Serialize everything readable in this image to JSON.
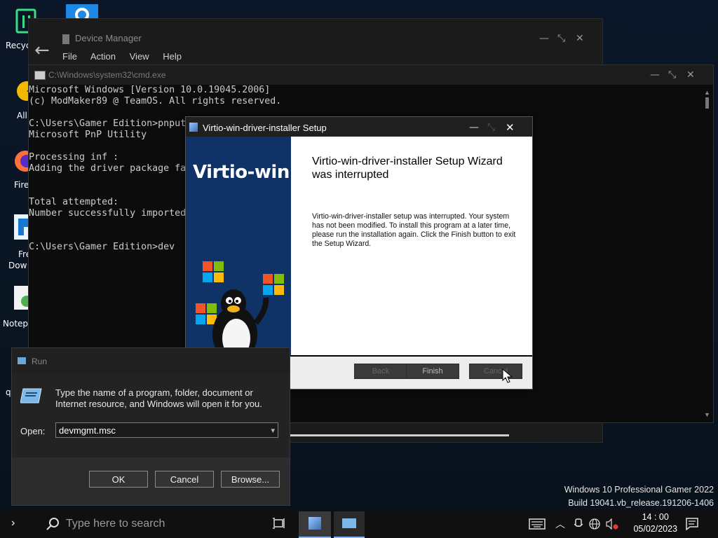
{
  "desktop": {
    "icons": [
      {
        "label": "Recyc"
      },
      {
        "label": "All"
      },
      {
        "label": "Fire"
      },
      {
        "label": "Fre"
      },
      {
        "label": "Dow"
      },
      {
        "label": "Notep"
      },
      {
        "label": "q"
      }
    ]
  },
  "device_manager": {
    "title": "Device Manager",
    "menu": [
      "File",
      "Action",
      "View",
      "Help"
    ]
  },
  "cmd": {
    "title": "C:\\Windows\\system32\\cmd.exe",
    "lines": [
      "Microsoft Windows [Version 10.0.19045.2006]",
      "(c) ModMaker89 @ TeamOS. All rights reserved.",
      "",
      "C:\\Users\\Gamer Edition>pnputi",
      "Microsoft PnP Utility",
      "",
      "Processing inf :",
      "Adding the driver package fa",
      "",
      "",
      "Total attempted:",
      "Number successfully imported",
      "",
      "",
      "C:\\Users\\Gamer Edition>dev"
    ]
  },
  "setup": {
    "title": "Virtio-win-driver-installer Setup",
    "brand": "Virtio-win",
    "heading": "Virtio-win-driver-installer Setup Wizard was interrupted",
    "body": "Virtio-win-driver-installer setup was interrupted. Your system has not been modified. To install this program at a later time, please run the installation again. Click the Finish button to exit the Setup Wizard.",
    "buttons": {
      "back": "Back",
      "finish": "Finish",
      "cancel": "Cancel"
    }
  },
  "run": {
    "title": "Run",
    "description": "Type the name of a program, folder, document or Internet resource, and Windows will open it for you.",
    "open_label": "Open:",
    "open_value": "devmgmt.msc",
    "buttons": {
      "ok": "OK",
      "cancel": "Cancel",
      "browse": "Browse..."
    }
  },
  "watermark": {
    "line1": "Windows 10 Professional Gamer 2022",
    "line2": "Build 19041.vb_release.191206-1406"
  },
  "taskbar": {
    "search_placeholder": "Type here to search",
    "time": "14 : 00",
    "date": "05/02/2023"
  }
}
